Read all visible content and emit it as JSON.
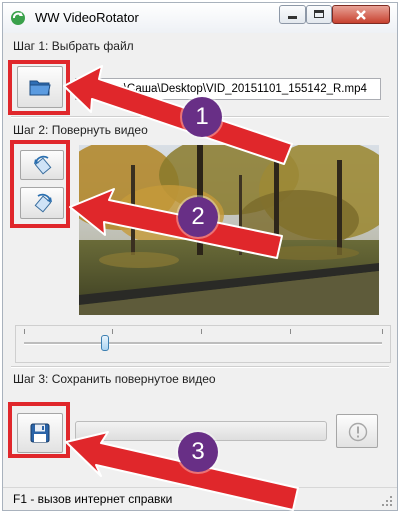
{
  "window": {
    "title": "WW VideoRotator"
  },
  "titlebar": {
    "minimize_icon": "minimize-icon",
    "maximize_icon": "maximize-icon",
    "close_icon": "close-icon"
  },
  "step1": {
    "label": "Шаг 1: Выбрать файл",
    "button_icon": "folder-icon",
    "file_path": "C:\\Users\\Саша\\Desktop\\VID_20151101_155142_R.mp4"
  },
  "step2": {
    "label": "Шаг 2: Повернуть видео",
    "rotate_left_icon": "rotate-left-icon",
    "rotate_right_icon": "rotate-right-icon"
  },
  "video_preview": {
    "description": "autumn-park-video-frame"
  },
  "slider": {
    "value_fraction": 0.23
  },
  "step3": {
    "label": "Шаг 3: Сохранить повернутое видео",
    "save_icon": "floppy-disk-icon",
    "info_icon": "exclamation-icon",
    "progress_fraction": 0
  },
  "statusbar": {
    "text": "F1 - вызов интернет справки"
  },
  "annotations": [
    {
      "number": "1"
    },
    {
      "number": "2"
    },
    {
      "number": "3"
    }
  ],
  "colors": {
    "highlight_red": "#e0272b",
    "badge_purple": "#682f86",
    "window_bg": "#f0f0f0"
  }
}
